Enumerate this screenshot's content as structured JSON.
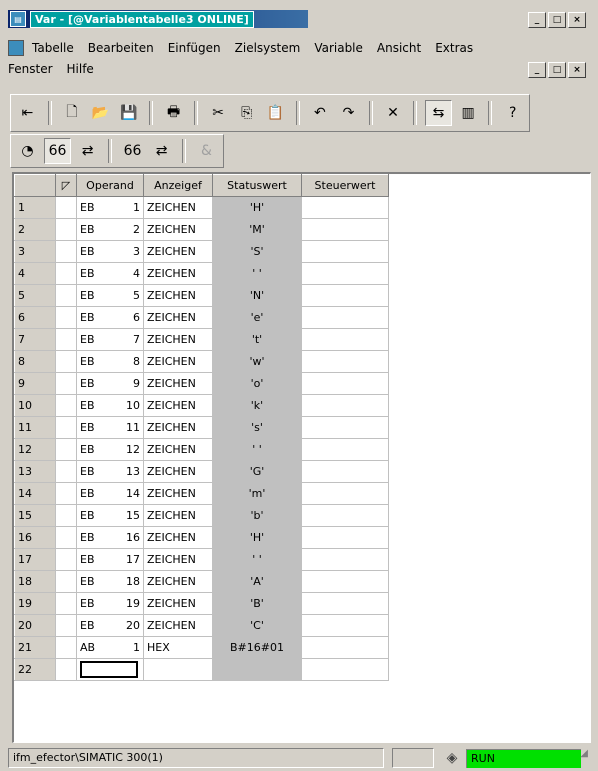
{
  "title": "Var - [@Variablentabelle3  ONLINE]",
  "window_buttons": [
    "_",
    "□",
    "×"
  ],
  "menu": {
    "row1": [
      "Tabelle",
      "Bearbeiten",
      "Einfügen",
      "Zielsystem",
      "Variable",
      "Ansicht",
      "Extras"
    ],
    "row2": [
      "Fenster",
      "Hilfe"
    ]
  },
  "toolbar1": [
    {
      "name": "pin-icon",
      "glyph": "⇤"
    },
    {
      "name": "new-icon",
      "glyph": "🗋"
    },
    {
      "name": "open-icon",
      "glyph": "📂"
    },
    {
      "name": "save-icon",
      "glyph": "💾"
    },
    {
      "name": "print-icon",
      "glyph": "🖶"
    },
    {
      "name": "cut-icon",
      "glyph": "✂"
    },
    {
      "name": "copy-icon",
      "glyph": "⎘"
    },
    {
      "name": "paste-icon",
      "glyph": "📋"
    },
    {
      "name": "undo-icon",
      "glyph": "↶"
    },
    {
      "name": "redo-icon",
      "glyph": "↷"
    },
    {
      "name": "delete-icon",
      "glyph": "✕"
    },
    {
      "name": "online-icon",
      "glyph": "⇆"
    },
    {
      "name": "module-icon",
      "glyph": "▥"
    },
    {
      "name": "help-icon",
      "glyph": "?"
    }
  ],
  "toolbar2": [
    {
      "name": "monitor-icon",
      "glyph": "◔"
    },
    {
      "name": "monitor-var-icon",
      "glyph": "66"
    },
    {
      "name": "modify-icon",
      "glyph": "⇄"
    },
    {
      "name": "monitor-once-icon",
      "glyph": "66"
    },
    {
      "name": "modify-once-icon",
      "glyph": "⇄"
    },
    {
      "name": "activate-icon",
      "glyph": "&"
    }
  ],
  "table": {
    "headers": [
      "Operand",
      "Anzeigef",
      "Statuswert",
      "Steuerwert"
    ],
    "rows": [
      {
        "num": "1",
        "op": "EB",
        "idx": "1",
        "fmt": "ZEICHEN",
        "status": "'H'"
      },
      {
        "num": "2",
        "op": "EB",
        "idx": "2",
        "fmt": "ZEICHEN",
        "status": "'M'"
      },
      {
        "num": "3",
        "op": "EB",
        "idx": "3",
        "fmt": "ZEICHEN",
        "status": "'S'"
      },
      {
        "num": "4",
        "op": "EB",
        "idx": "4",
        "fmt": "ZEICHEN",
        "status": "' '"
      },
      {
        "num": "5",
        "op": "EB",
        "idx": "5",
        "fmt": "ZEICHEN",
        "status": "'N'"
      },
      {
        "num": "6",
        "op": "EB",
        "idx": "6",
        "fmt": "ZEICHEN",
        "status": "'e'"
      },
      {
        "num": "7",
        "op": "EB",
        "idx": "7",
        "fmt": "ZEICHEN",
        "status": "'t'"
      },
      {
        "num": "8",
        "op": "EB",
        "idx": "8",
        "fmt": "ZEICHEN",
        "status": "'w'"
      },
      {
        "num": "9",
        "op": "EB",
        "idx": "9",
        "fmt": "ZEICHEN",
        "status": "'o'"
      },
      {
        "num": "10",
        "op": "EB",
        "idx": "10",
        "fmt": "ZEICHEN",
        "status": "'k'"
      },
      {
        "num": "11",
        "op": "EB",
        "idx": "11",
        "fmt": "ZEICHEN",
        "status": "'s'"
      },
      {
        "num": "12",
        "op": "EB",
        "idx": "12",
        "fmt": "ZEICHEN",
        "status": "' '"
      },
      {
        "num": "13",
        "op": "EB",
        "idx": "13",
        "fmt": "ZEICHEN",
        "status": "'G'"
      },
      {
        "num": "14",
        "op": "EB",
        "idx": "14",
        "fmt": "ZEICHEN",
        "status": "'m'"
      },
      {
        "num": "15",
        "op": "EB",
        "idx": "15",
        "fmt": "ZEICHEN",
        "status": "'b'"
      },
      {
        "num": "16",
        "op": "EB",
        "idx": "16",
        "fmt": "ZEICHEN",
        "status": "'H'"
      },
      {
        "num": "17",
        "op": "EB",
        "idx": "17",
        "fmt": "ZEICHEN",
        "status": "' '"
      },
      {
        "num": "18",
        "op": "EB",
        "idx": "18",
        "fmt": "ZEICHEN",
        "status": "'A'"
      },
      {
        "num": "19",
        "op": "EB",
        "idx": "19",
        "fmt": "ZEICHEN",
        "status": "'B'"
      },
      {
        "num": "20",
        "op": "EB",
        "idx": "20",
        "fmt": "ZEICHEN",
        "status": "'C'"
      },
      {
        "num": "21",
        "op": "AB",
        "idx": "1",
        "fmt": "HEX",
        "status": "B#16#01"
      },
      {
        "num": "22",
        "op": "",
        "idx": "",
        "fmt": "",
        "status": ""
      }
    ]
  },
  "statusbar": {
    "path": "ifm_efector\\SIMATIC 300(1)",
    "mode": "RUN",
    "mode_color": "#00e000"
  }
}
